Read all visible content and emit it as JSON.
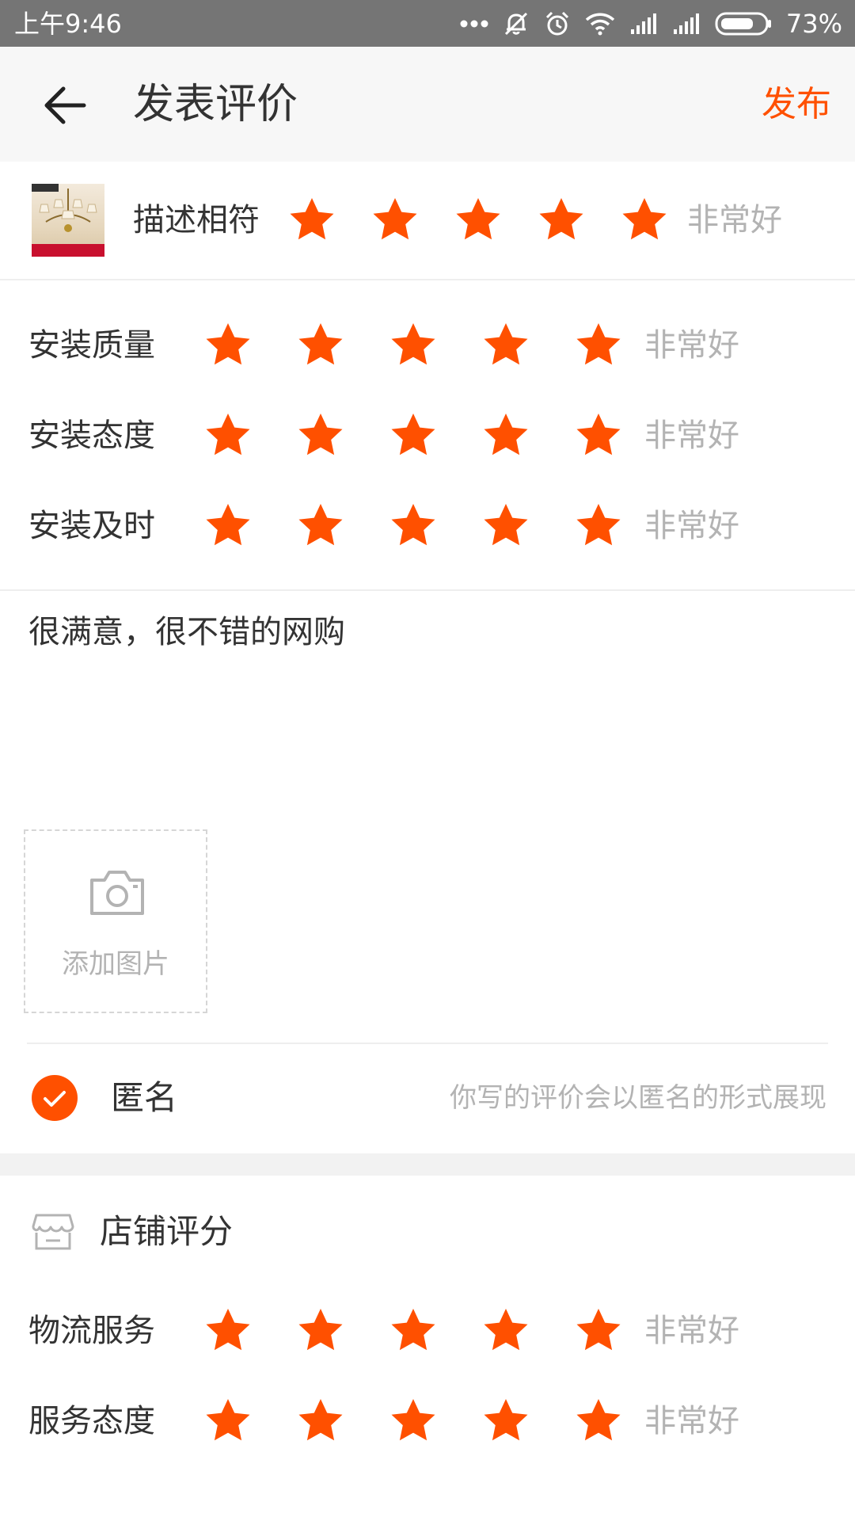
{
  "status_bar": {
    "time": "上午9:46",
    "battery": "73%"
  },
  "header": {
    "title": "发表评价",
    "publish_label": "发布"
  },
  "product": {
    "label": "描述相符",
    "rating": 5,
    "max_rating": 5,
    "rating_text": "非常好"
  },
  "service_ratings": [
    {
      "label": "安装质量",
      "rating": 5,
      "rating_text": "非常好"
    },
    {
      "label": "安装态度",
      "rating": 5,
      "rating_text": "非常好"
    },
    {
      "label": "安装及时",
      "rating": 5,
      "rating_text": "非常好"
    }
  ],
  "review": {
    "text": "很满意，很不错的网购"
  },
  "add_photo": {
    "label": "添加图片"
  },
  "anonymous": {
    "checked": true,
    "label": "匿名",
    "hint": "你写的评价会以匿名的形式展现"
  },
  "shop": {
    "title": "店铺评分",
    "ratings": [
      {
        "label": "物流服务",
        "rating": 5,
        "rating_text": "非常好"
      },
      {
        "label": "服务态度",
        "rating": 5,
        "rating_text": "非常好"
      }
    ]
  },
  "colors": {
    "accent": "#ff5000",
    "status_bar": "#757575",
    "header_bg": "#f7f7f7",
    "muted_text": "#b3b3b3"
  }
}
